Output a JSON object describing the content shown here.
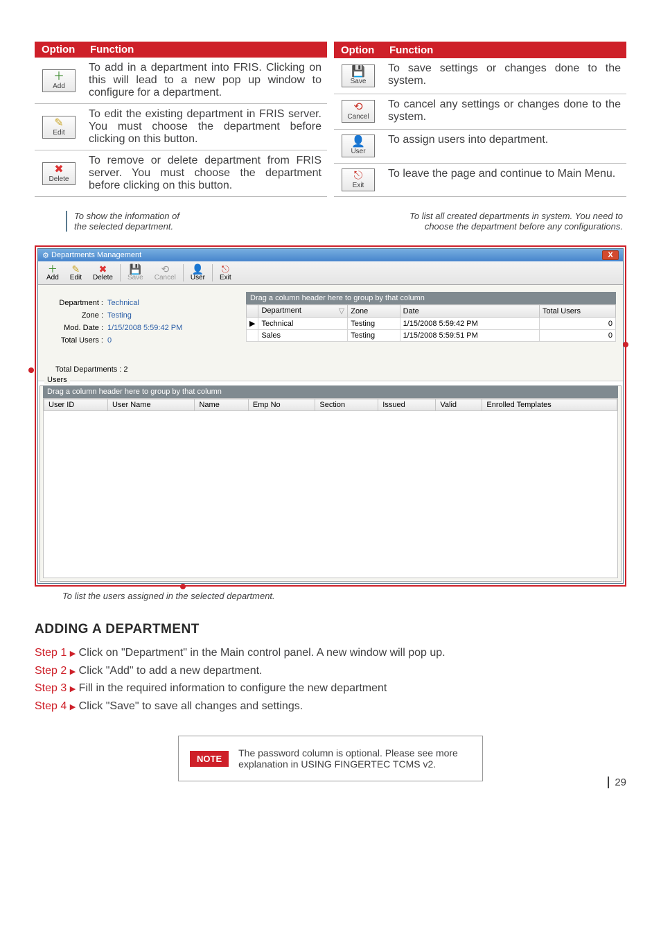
{
  "page_number": "29",
  "left_table": {
    "headers": [
      "Option",
      "Function"
    ],
    "rows": [
      {
        "icon_glyph": "＋",
        "icon_color": "#3a8a2b",
        "label": "Add",
        "desc": "To add in a department into FRIS. Clicking on this will lead to a new pop up window to configure for a department."
      },
      {
        "icon_glyph": "✎",
        "icon_color": "#caa62b",
        "label": "Edit",
        "desc": "To edit the existing department in FRIS server. You must choose the department before clicking on this button."
      },
      {
        "icon_glyph": "✖",
        "icon_color": "#d33",
        "label": "Delete",
        "desc": "To remove or delete department from FRIS server. You must choose the department before clicking on this button."
      }
    ]
  },
  "right_table": {
    "headers": [
      "Option",
      "Function"
    ],
    "rows": [
      {
        "icon_glyph": "💾",
        "icon_color": "#3c6fa3",
        "label": "Save",
        "desc": "To save settings or changes done to the system."
      },
      {
        "icon_glyph": "⟲",
        "icon_color": "#c9352b",
        "label": "Cancel",
        "desc": "To cancel any settings or changes done to the system."
      },
      {
        "icon_glyph": "👤",
        "icon_color": "#3a7e35",
        "label": "User",
        "desc": "To assign users into department."
      },
      {
        "icon_glyph": "⎋",
        "icon_color": "#c9352b",
        "label": "Exit",
        "desc": "To leave the page and continue to Main Menu."
      }
    ]
  },
  "annotations": {
    "top_left_l1": "To show the information of",
    "top_left_l2": "the selected department.",
    "top_right_l1": "To list all created departments in system. You need to",
    "top_right_l2": "choose the department before any configurations.",
    "bottom": "To list the users assigned in the selected department."
  },
  "window": {
    "title": "Departments Management",
    "toolbar": [
      {
        "glyph": "＋",
        "color": "#3a8a2b",
        "label": "Add",
        "disabled": false
      },
      {
        "glyph": "✎",
        "color": "#caa62b",
        "label": "Edit",
        "disabled": false
      },
      {
        "glyph": "✖",
        "color": "#d33",
        "label": "Delete",
        "disabled": false
      },
      {
        "glyph": "💾",
        "color": "#888",
        "label": "Save",
        "disabled": true
      },
      {
        "glyph": "⟲",
        "color": "#888",
        "label": "Cancel",
        "disabled": true
      },
      {
        "glyph": "👤",
        "color": "#3a7e35",
        "label": "User",
        "disabled": false
      },
      {
        "glyph": "⎋",
        "color": "#c9352b",
        "label": "Exit",
        "disabled": false
      }
    ],
    "info": {
      "dept_label": "Department :",
      "dept_value": "Technical",
      "zone_label": "Zone :",
      "zone_value": "Testing",
      "mod_label": "Mod. Date :",
      "mod_value": "1/15/2008 5:59:42 PM",
      "users_label": "Total Users :",
      "users_value": "0",
      "total_dept": "Total Departments : 2"
    },
    "group_header": "Drag a column header here to group by that column",
    "dept_columns": [
      "Department",
      "Zone",
      "Date",
      "Total Users"
    ],
    "dept_rows": [
      {
        "marker": "▶",
        "dept": "Technical",
        "zone": "Testing",
        "date": "1/15/2008 5:59:42 PM",
        "users": "0"
      },
      {
        "marker": "",
        "dept": "Sales",
        "zone": "Testing",
        "date": "1/15/2008 5:59:51 PM",
        "users": "0"
      }
    ],
    "users_legend": "Users",
    "users_group_header": "Drag a column header here to group by that column",
    "users_columns": [
      "User ID",
      "User Name",
      "Name",
      "Emp No",
      "Section",
      "Issued",
      "Valid",
      "Enrolled Templates"
    ]
  },
  "heading": "ADDING A DEPARTMENT",
  "steps": [
    {
      "label": "Step 1",
      "text": "Click on \"Department\" in the Main control panel. A new window will pop up."
    },
    {
      "label": "Step 2",
      "text": "Click \"Add\" to add a new department."
    },
    {
      "label": "Step 3",
      "text": "Fill in the required information to configure the new department"
    },
    {
      "label": "Step 4",
      "text": "Click \"Save\" to save all changes and settings."
    }
  ],
  "note": {
    "badge": "NOTE",
    "text": "The password column is optional. Please see more explanation in USING FINGERTEC TCMS v2."
  }
}
